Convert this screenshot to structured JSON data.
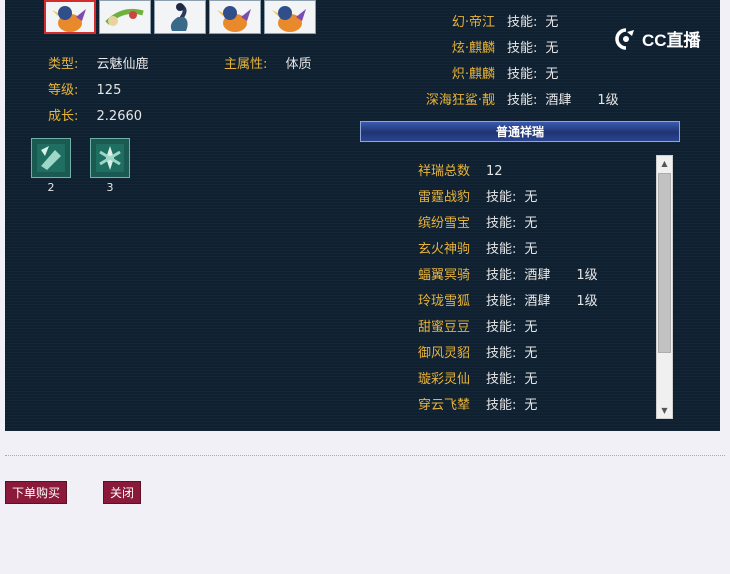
{
  "pets": [
    {
      "name": "pet-1",
      "selected": true
    },
    {
      "name": "pet-2",
      "selected": false
    },
    {
      "name": "pet-3",
      "selected": false
    },
    {
      "name": "pet-4",
      "selected": false
    },
    {
      "name": "pet-5",
      "selected": false
    }
  ],
  "info": {
    "type_label": "类型:",
    "type_value": "云魅仙鹿",
    "attr_label": "主属性:",
    "attr_value": "体质",
    "level_label": "等级:",
    "level_value": "125",
    "growth_label": "成长:",
    "growth_value": "2.2660"
  },
  "skills": [
    {
      "icon": "skill-icon-1",
      "count": "2"
    },
    {
      "icon": "skill-icon-2",
      "count": "3"
    }
  ],
  "right_top": [
    {
      "name": "幻·帝江",
      "skill_label": "技能:",
      "skill_value": "无",
      "level": ""
    },
    {
      "name": "炫·麒麟",
      "skill_label": "技能:",
      "skill_value": "无",
      "level": ""
    },
    {
      "name": "炽·麒麟",
      "skill_label": "技能:",
      "skill_value": "无",
      "level": ""
    },
    {
      "name": "深海狂鲨·靓",
      "skill_label": "技能:",
      "skill_value": "酒肆",
      "level": "1级"
    }
  ],
  "section_title": "普通祥瑞",
  "xiangrui": {
    "total_label": "祥瑞总数",
    "total_value": "12",
    "items": [
      {
        "name": "雷霆战豹",
        "skill_label": "技能:",
        "skill_value": "无",
        "level": ""
      },
      {
        "name": "缤纷雪宝",
        "skill_label": "技能:",
        "skill_value": "无",
        "level": ""
      },
      {
        "name": "玄火神驹",
        "skill_label": "技能:",
        "skill_value": "无",
        "level": ""
      },
      {
        "name": "蝠翼冥骑",
        "skill_label": "技能:",
        "skill_value": "酒肆",
        "level": "1级"
      },
      {
        "name": "玲珑雪狐",
        "skill_label": "技能:",
        "skill_value": "酒肆",
        "level": "1级"
      },
      {
        "name": "甜蜜豆豆",
        "skill_label": "技能:",
        "skill_value": "无",
        "level": ""
      },
      {
        "name": "御风灵貂",
        "skill_label": "技能:",
        "skill_value": "无",
        "level": ""
      },
      {
        "name": "璇彩灵仙",
        "skill_label": "技能:",
        "skill_value": "无",
        "level": ""
      },
      {
        "name": "穿云飞辇",
        "skill_label": "技能:",
        "skill_value": "无",
        "level": ""
      }
    ]
  },
  "watermark": "CC直播",
  "buttons": {
    "buy": "下单购买",
    "close": "关闭"
  },
  "colors": {
    "panel_bg": "#0f2030",
    "label_gold": "#e8b33a",
    "button_red": "#8b1a3a"
  }
}
